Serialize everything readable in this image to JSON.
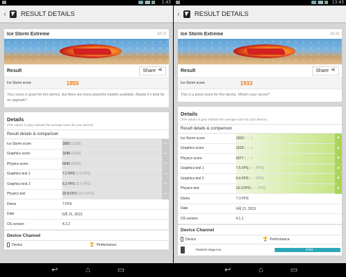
{
  "left": {
    "status_time": "1:43",
    "title": "RESULT DETAILS",
    "benchmark": {
      "name": "Ice Storm Extreme",
      "version": "(v1.1)"
    },
    "result_label": "Result",
    "share_label": "Share",
    "score_label": "Ice Storm score",
    "score_value": "1855",
    "score_note": "Your score is good for this device, but there are more powerful models available. Maybe it's time for an upgrade?",
    "details_title": "Details",
    "details_sub": "(The values in grey indicate the average score for your device)",
    "section": "Result details & comparison",
    "rows": [
      {
        "label": "Ice Storm score",
        "value": "1855",
        "avg": "(1909)"
      },
      {
        "label": "Graphics score",
        "value": "1548",
        "avg": "(1593)"
      },
      {
        "label": "Physics score",
        "value": "6545",
        "avg": "(6636)"
      },
      {
        "label": "Graphics test 1",
        "value": "7.2 FPS",
        "avg": "(7.6 FPS)"
      },
      {
        "label": "Graphics test 2",
        "value": "6.2 FPS",
        "avg": "(6.5 FPS)"
      },
      {
        "label": "Physics test",
        "value": "20.8 FPS",
        "avg": "(16.2 FPS)"
      }
    ],
    "info_rows": [
      {
        "label": "Demo",
        "value": "7 FPS"
      },
      {
        "label": "Date",
        "value": "6月 21, 2013"
      },
      {
        "label": "OS version",
        "value": "4.2.2"
      }
    ],
    "device_channel": "Device Channel",
    "device_col": "Device",
    "perf_col": "Performance"
  },
  "right": {
    "status_time": "13:43",
    "title": "RESULT DETAILS",
    "benchmark": {
      "name": "Ice Storm Extreme",
      "version": "(v1.1)"
    },
    "result_label": "Result",
    "share_label": "Share",
    "score_label": "Ice Storm score",
    "score_value": "1933",
    "score_note": "This is a great score for this device. What's your secret?",
    "details_title": "Details",
    "details_sub": "(The values in grey indicate the average score for your device)",
    "section": "Result details & comparison",
    "rows": [
      {
        "label": "Ice Storm score",
        "value": "1933",
        "avg": "( --- )"
      },
      {
        "label": "Graphics score",
        "value": "1618",
        "avg": "( --- )"
      },
      {
        "label": "Physics score",
        "value": "6077",
        "avg": "( --- )"
      },
      {
        "label": "Graphics test 1",
        "value": "7.5 FPS",
        "avg": "( --- FPS)"
      },
      {
        "label": "Graphics test 2",
        "value": "6.6 FPS",
        "avg": "( --- FPS)"
      },
      {
        "label": "Physics test",
        "value": "19.3 FPS",
        "avg": "( --- FPS)"
      }
    ],
    "info_rows": [
      {
        "label": "Demo",
        "value": "7.3 FPS"
      },
      {
        "label": "Date",
        "value": "6月 21, 2013"
      },
      {
        "label": "OS version",
        "value": "4.1.1"
      }
    ],
    "device_channel": "Device Channel",
    "device_col": "Device",
    "perf_col": "Performance",
    "device_name": "Pantech Vega Iron",
    "device_score": "6783"
  },
  "icons": {
    "back": "back-arrow-icon",
    "home": "home-icon",
    "recents": "recents-icon",
    "share": "share-icon"
  },
  "colors": {
    "score": "#f07a1a",
    "bar": "#2aa8b8",
    "highlight": "#a9d45a"
  }
}
